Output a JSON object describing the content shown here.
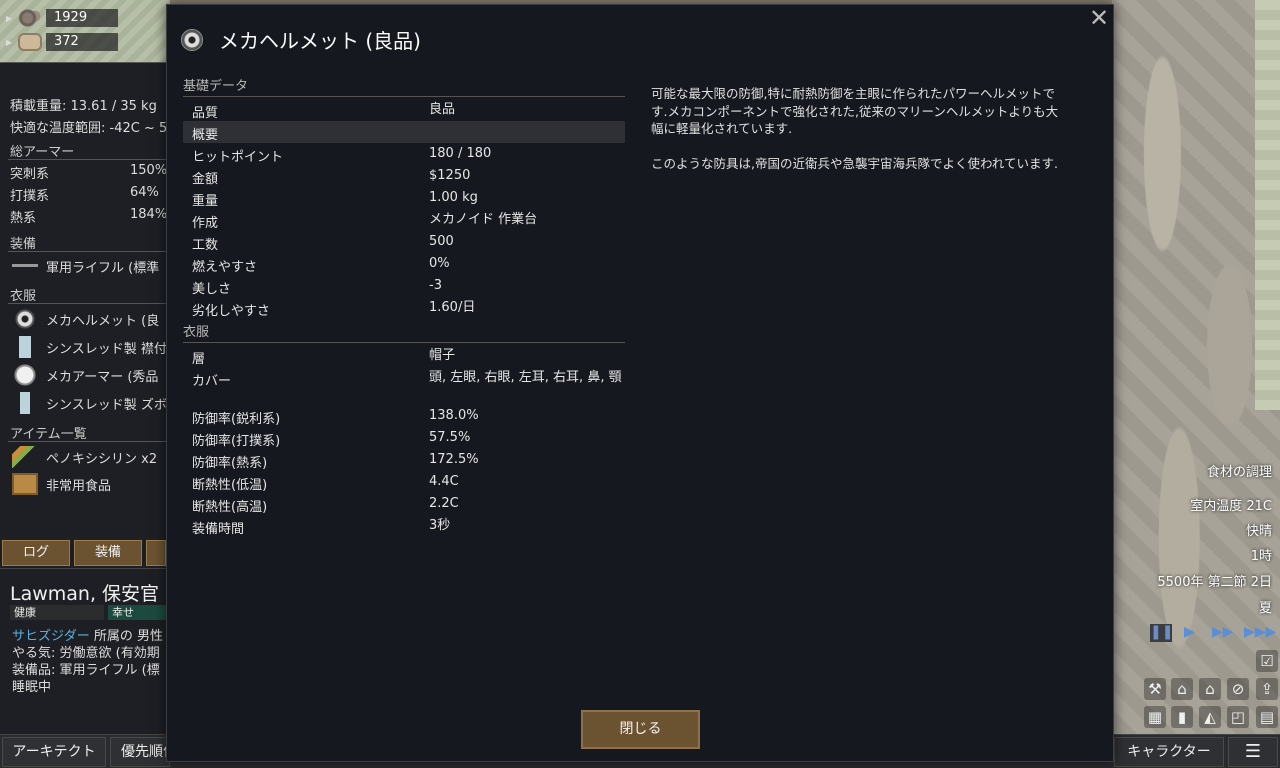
{
  "resources": [
    {
      "icon": "silver-icon",
      "value": "1929"
    },
    {
      "icon": "stone-block-icon",
      "value": "372"
    }
  ],
  "left_panel": {
    "carry_weight": "積載重量: 13.61 / 35 kg",
    "comfy_temp": "快適な温度範囲: -42C ~ 5",
    "armor_head": "総アーマー",
    "armor": [
      {
        "label": "突刺系",
        "value": "150%"
      },
      {
        "label": "打撲系",
        "value": "64%"
      },
      {
        "label": "熱系",
        "value": "184%"
      }
    ],
    "equipment_head": "装備",
    "equipment": [
      "軍用ライフル (標準"
    ],
    "apparel_head": "衣服",
    "apparel": [
      "メカヘルメット (良",
      "シンスレッド製 襟付",
      "メカアーマー (秀品",
      "シンスレッド製 ズボ"
    ],
    "inventory_head": "アイテム一覧",
    "inventory": [
      "ペノキシシリン x2",
      "非常用食品"
    ]
  },
  "tabs": [
    "ログ",
    "装備",
    ""
  ],
  "character": {
    "name": "Lawman, 保安官",
    "health_label": "健康",
    "mood_label": "幸せ",
    "faction": "サヒズジダー",
    "faction_rest": " 所属の 男性",
    "motivation": "やる気: 労働意欲 (有効期",
    "equipped": "装備品: 軍用ライフル (標",
    "status": "睡眠中"
  },
  "bottom_bar": {
    "architect": "アーキテクト",
    "priority": "優先順位",
    "characters": "キャラクター",
    "menu_icon": "list-icon"
  },
  "right_overlay": {
    "activity": "食材の調理",
    "indoor_temp": "室内温度 21C",
    "weather": "快晴",
    "hour": "1時",
    "date": "5500年 第二節 2日",
    "season": "夏"
  },
  "dialog": {
    "title": "メカヘルメット (良品)",
    "sections": [
      {
        "heading": "基礎データ",
        "rows": [
          {
            "k": "品質",
            "v": "良品"
          },
          {
            "k": "概要",
            "v": ""
          },
          {
            "k": "ヒットポイント",
            "v": "180 / 180"
          },
          {
            "k": "金額",
            "v": "$1250"
          },
          {
            "k": "重量",
            "v": "1.00 kg"
          },
          {
            "k": "作成",
            "v": "メカノイド 作業台"
          },
          {
            "k": "工数",
            "v": "500"
          },
          {
            "k": "燃えやすさ",
            "v": "0%"
          },
          {
            "k": "美しさ",
            "v": "-3"
          },
          {
            "k": "劣化しやすさ",
            "v": "1.60/日"
          }
        ]
      },
      {
        "heading": "衣服",
        "rows": [
          {
            "k": "層",
            "v": "帽子"
          },
          {
            "k": "カバー",
            "v": "頭, 左眼, 右眼, 左耳, 右耳, 鼻, 顎"
          },
          {
            "k": "防御率(鋭利系)",
            "v": "138.0%"
          },
          {
            "k": "防御率(打撲系)",
            "v": "57.5%"
          },
          {
            "k": "防御率(熱系)",
            "v": "172.5%"
          },
          {
            "k": "断熱性(低温)",
            "v": "4.4C"
          },
          {
            "k": "断熱性(高温)",
            "v": "2.2C"
          },
          {
            "k": "装備時間",
            "v": "3秒"
          }
        ]
      }
    ],
    "description": [
      "可能な最大限の防御,特に耐熱防御を主眼に作られたパワーヘルメットです.メカコンポーネントで強化された,従来のマリーンヘルメットよりも大幅に軽量化されています.",
      "このような防具は,帝国の近衛兵や急襲宇宙海兵隊でよく使われています."
    ],
    "close_label": "閉じる"
  }
}
